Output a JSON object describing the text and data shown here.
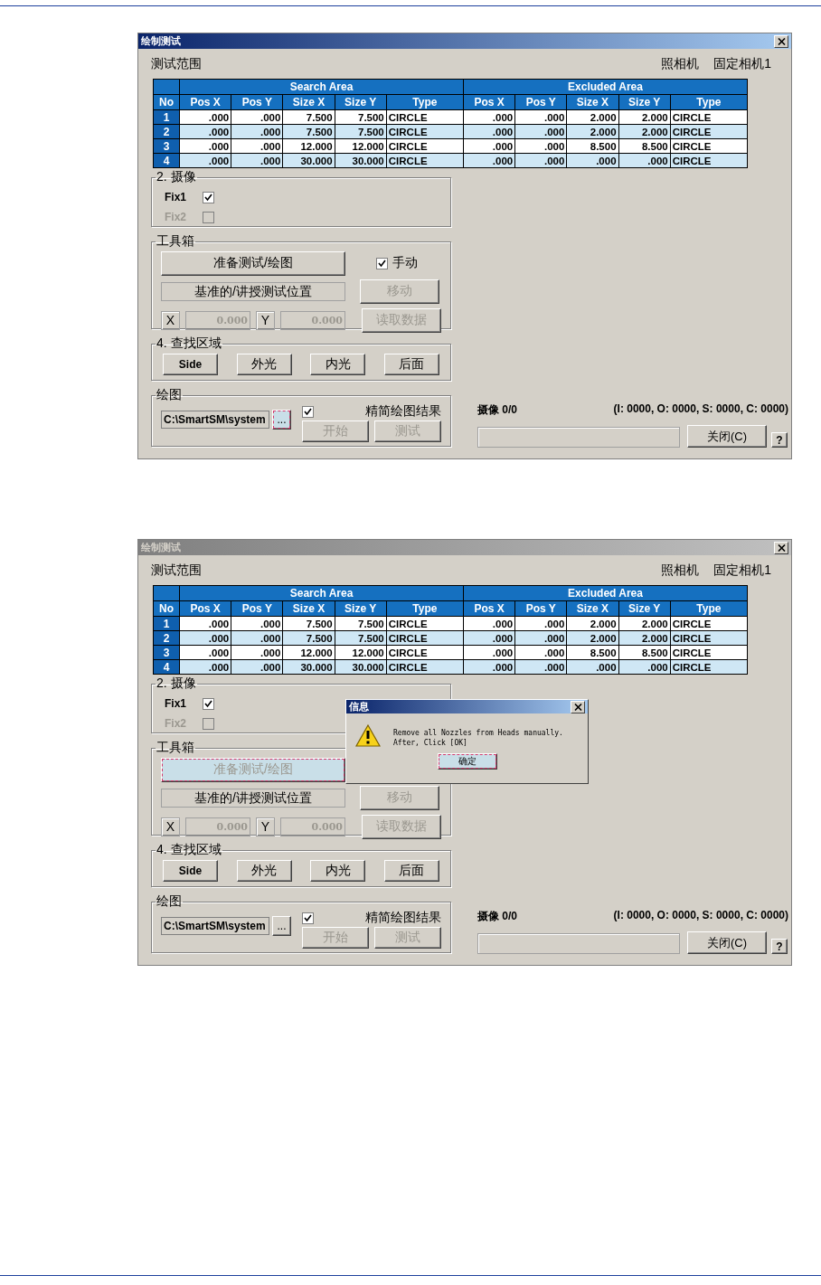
{
  "screenshots": [
    {
      "title": "绘制测试",
      "active": true,
      "range_label": "测试范围",
      "camera_label": "照相机",
      "camera_value": "固定相机1",
      "table": {
        "groups": [
          "Search Area",
          "Excluded Area"
        ],
        "columns": [
          "No",
          "Pos X",
          "Pos Y",
          "Size X",
          "Size Y",
          "Type",
          "Pos X",
          "Pos Y",
          "Size X",
          "Size Y",
          "Type"
        ],
        "rows": [
          [
            "1",
            ".000",
            ".000",
            "7.500",
            "7.500",
            "CIRCLE",
            ".000",
            ".000",
            "2.000",
            "2.000",
            "CIRCLE"
          ],
          [
            "2",
            ".000",
            ".000",
            "7.500",
            "7.500",
            "CIRCLE",
            ".000",
            ".000",
            "2.000",
            "2.000",
            "CIRCLE"
          ],
          [
            "3",
            ".000",
            ".000",
            "12.000",
            "12.000",
            "CIRCLE",
            ".000",
            ".000",
            "8.500",
            "8.500",
            "CIRCLE"
          ],
          [
            "4",
            ".000",
            ".000",
            "30.000",
            "30.000",
            "CIRCLE",
            ".000",
            ".000",
            ".000",
            ".000",
            "CIRCLE"
          ]
        ]
      },
      "camera_group": {
        "title": "2. 摄像",
        "items": [
          {
            "label": "Fix1",
            "checked": true,
            "disabled": false
          },
          {
            "label": "Fix2",
            "checked": false,
            "disabled": true
          }
        ]
      },
      "toolbox": {
        "title": "工具箱",
        "prepare_button": {
          "label": "准备测试/绘图",
          "focused": false,
          "disabled": false
        },
        "manual": {
          "label": "手动",
          "checked": true
        },
        "position_label": "基准的/讲授测试位置",
        "move_button": {
          "label": "移动",
          "disabled": true
        },
        "read_button": {
          "label": "读取数据",
          "disabled": true
        },
        "x_label": "X",
        "x_field": {
          "value": "0.000",
          "disabled": true
        },
        "y_label": "Y",
        "y_field": {
          "value": "0.000",
          "disabled": true
        }
      },
      "find_group": {
        "title": "4. 查找区域",
        "buttons": [
          "Side",
          "外光",
          "内光",
          "后面"
        ]
      },
      "draw_group": {
        "title": "绘图",
        "path": "C:\\SmartSM\\system",
        "browse_button": {
          "label": "...",
          "focused": true
        },
        "simplify": {
          "label": "精简绘图结果",
          "checked": true
        },
        "start_button": {
          "label": "开始",
          "disabled": true
        },
        "test_button": {
          "label": "测试",
          "disabled": true
        }
      },
      "status": {
        "camera": "摄像 0/0",
        "counts": "(I: 0000, O: 0000, S: 0000, C: 0000)",
        "progress": {
          "level": 0
        }
      },
      "close_button": "关闭(C)",
      "help_button": "?"
    },
    {
      "title": "绘制测试",
      "active": false,
      "range_label": "测试范围",
      "camera_label": "照相机",
      "camera_value": "固定相机1",
      "table": {
        "groups": [
          "Search Area",
          "Excluded Area"
        ],
        "columns": [
          "No",
          "Pos X",
          "Pos Y",
          "Size X",
          "Size Y",
          "Type",
          "Pos X",
          "Pos Y",
          "Size X",
          "Size Y",
          "Type"
        ],
        "rows": [
          [
            "1",
            ".000",
            ".000",
            "7.500",
            "7.500",
            "CIRCLE",
            ".000",
            ".000",
            "2.000",
            "2.000",
            "CIRCLE"
          ],
          [
            "2",
            ".000",
            ".000",
            "7.500",
            "7.500",
            "CIRCLE",
            ".000",
            ".000",
            "2.000",
            "2.000",
            "CIRCLE"
          ],
          [
            "3",
            ".000",
            ".000",
            "12.000",
            "12.000",
            "CIRCLE",
            ".000",
            ".000",
            "8.500",
            "8.500",
            "CIRCLE"
          ],
          [
            "4",
            ".000",
            ".000",
            "30.000",
            "30.000",
            "CIRCLE",
            ".000",
            ".000",
            ".000",
            ".000",
            "CIRCLE"
          ]
        ]
      },
      "camera_group": {
        "title": "2. 摄像",
        "items": [
          {
            "label": "Fix1",
            "checked": true,
            "disabled": false
          },
          {
            "label": "Fix2",
            "checked": false,
            "disabled": true
          }
        ]
      },
      "toolbox": {
        "title": "工具箱",
        "prepare_button": {
          "label": "准备测试/绘图",
          "focused": true,
          "disabled": true
        },
        "position_label": "基准的/讲授测试位置",
        "move_button": {
          "label": "移动",
          "disabled": true
        },
        "read_button": {
          "label": "读取数据",
          "disabled": true
        },
        "x_label": "X",
        "x_field": {
          "value": "0.000",
          "disabled": true
        },
        "y_label": "Y",
        "y_field": {
          "value": "0.000",
          "disabled": true
        }
      },
      "find_group": {
        "title": "4. 查找区域",
        "buttons": [
          "Side",
          "外光",
          "内光",
          "后面"
        ]
      },
      "draw_group": {
        "title": "绘图",
        "path": "C:\\SmartSM\\system",
        "browse_button": {
          "label": "...",
          "focused": false
        },
        "simplify": {
          "label": "精简绘图结果",
          "checked": true
        },
        "start_button": {
          "label": "开始",
          "disabled": true
        },
        "test_button": {
          "label": "测试",
          "disabled": true
        }
      },
      "status": {
        "camera": "摄像 0/0",
        "counts": "(I: 0000, O: 0000, S: 0000, C: 0000)",
        "progress": {
          "level": 0
        }
      },
      "close_button": "关闭(C)",
      "help_button": "?",
      "dialog": {
        "title": "信息",
        "lines": [
          "Remove all Nozzles from Heads manually.",
          "After, Click [OK]"
        ],
        "ok_button": "确定"
      }
    }
  ]
}
